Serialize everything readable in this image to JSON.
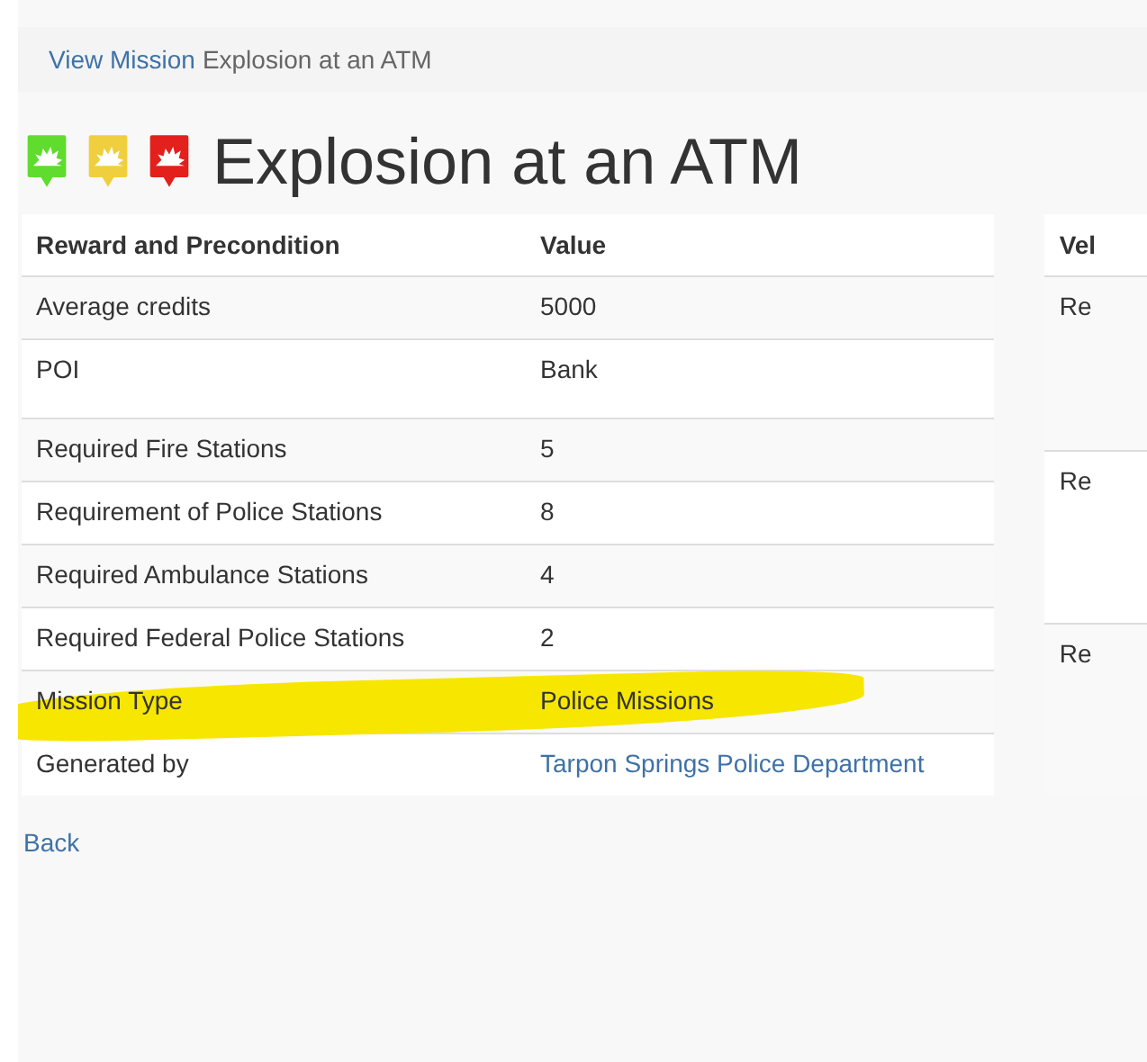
{
  "breadcrumb": {
    "link": "View Mission",
    "current": "Explosion at an ATM"
  },
  "title": "Explosion at an ATM",
  "badges": [
    {
      "color": "#5fdc2e"
    },
    {
      "color": "#f0cf3e"
    },
    {
      "color": "#e3201b"
    }
  ],
  "table": {
    "columns": [
      "Reward and Precondition",
      "Value"
    ],
    "rows": [
      {
        "label": "Average credits",
        "value": "5000",
        "kind": "text",
        "highlighted": false
      },
      {
        "label": "POI",
        "value": "Bank",
        "kind": "text",
        "highlighted": false
      },
      {
        "label": "Required Fire Stations",
        "value": "5",
        "kind": "text",
        "highlighted": false
      },
      {
        "label": "Requirement of Police Stations",
        "value": "8",
        "kind": "text",
        "highlighted": false
      },
      {
        "label": "Required Ambulance Stations",
        "value": "4",
        "kind": "text",
        "highlighted": false
      },
      {
        "label": "Required Federal Police Stations",
        "value": "2",
        "kind": "text",
        "highlighted": false
      },
      {
        "label": "Mission Type",
        "value": "Police Missions",
        "kind": "text",
        "highlighted": true
      },
      {
        "label": "Generated by",
        "value": "Tarpon Springs Police Department",
        "kind": "link",
        "highlighted": false
      }
    ]
  },
  "side_table": {
    "column": "Vel",
    "rows": [
      "Re",
      "Re",
      "Re"
    ]
  },
  "back_link": "Back"
}
